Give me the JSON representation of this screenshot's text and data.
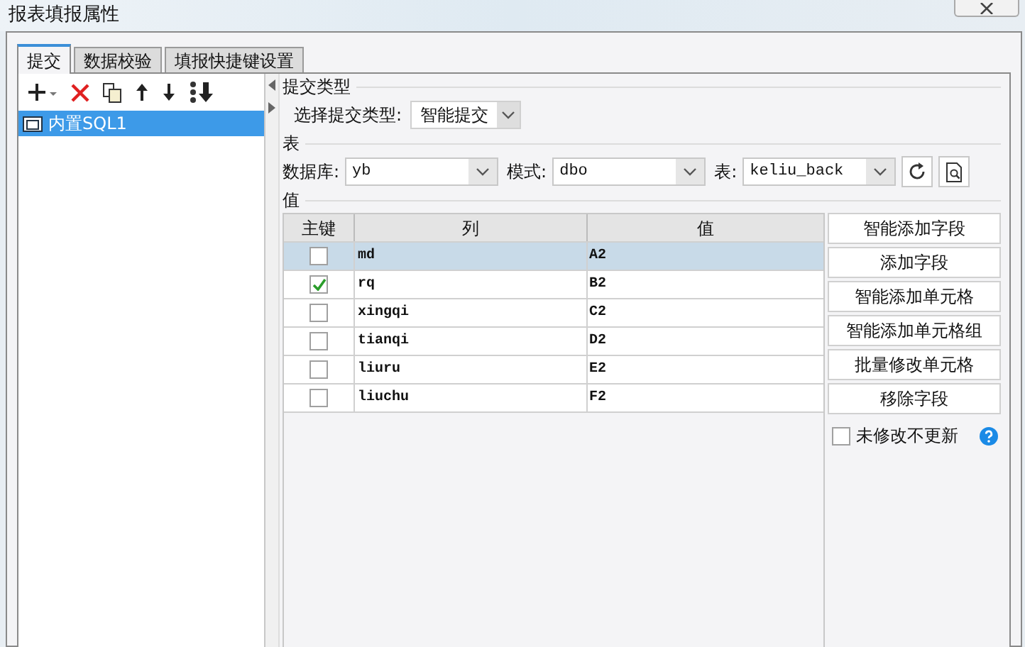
{
  "window": {
    "title": "报表填报属性"
  },
  "tabs": [
    {
      "label": "提交",
      "selected": true
    },
    {
      "label": "数据校验",
      "selected": false
    },
    {
      "label": "填报快捷键设置",
      "selected": false
    }
  ],
  "submissions": [
    {
      "label": "内置SQL1",
      "selected": true
    }
  ],
  "submit_type": {
    "heading": "提交类型",
    "label": "选择提交类型:",
    "value": "智能提交"
  },
  "table_section": {
    "heading": "表",
    "database": {
      "label": "数据库:",
      "value": "yb"
    },
    "schema": {
      "label": "模式:",
      "value": "dbo"
    },
    "table": {
      "label": "表:",
      "value": "keliu_back"
    }
  },
  "values_section": {
    "heading": "值",
    "columns": [
      "主键",
      "列",
      "值"
    ],
    "rows": [
      {
        "primary_key": false,
        "column": "md",
        "value": "A2",
        "selected": true
      },
      {
        "primary_key": true,
        "column": "rq",
        "value": "B2",
        "selected": false
      },
      {
        "primary_key": false,
        "column": "xingqi",
        "value": "C2",
        "selected": false
      },
      {
        "primary_key": false,
        "column": "tianqi",
        "value": "D2",
        "selected": false
      },
      {
        "primary_key": false,
        "column": "liuru",
        "value": "E2",
        "selected": false
      },
      {
        "primary_key": false,
        "column": "liuchu",
        "value": "F2",
        "selected": false
      }
    ]
  },
  "actions": [
    "智能添加字段",
    "添加字段",
    "智能添加单元格",
    "智能添加单元格组",
    "批量修改单元格",
    "移除字段"
  ],
  "skip_unchanged": {
    "label": "未修改不更新",
    "checked": false
  }
}
